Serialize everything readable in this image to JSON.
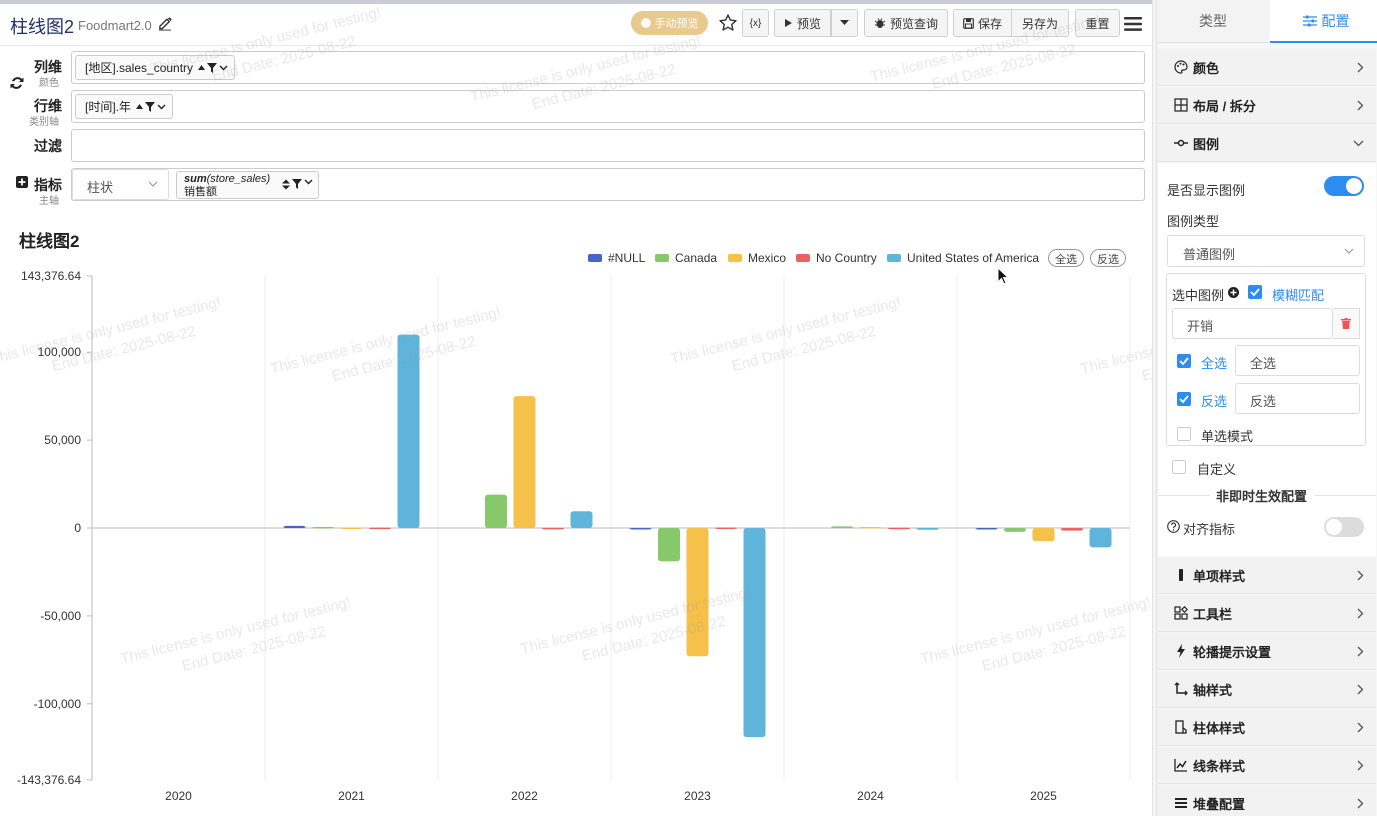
{
  "header": {
    "title": "柱线图2",
    "subtitle": "Foodmart2.0",
    "manual_preview": "手动预览",
    "var_label": "{x}",
    "preview": "预览",
    "preview_query": "预览查询",
    "save": "保存",
    "save_as": "另存为",
    "reset": "重置"
  },
  "shelves": {
    "col": {
      "label": "列维",
      "sub": "颜色",
      "chip": "[地区].sales_country"
    },
    "row": {
      "label": "行维",
      "sub": "类别轴",
      "chip": "[时间].年"
    },
    "filter": {
      "label": "过滤"
    },
    "metric": {
      "label": "指标",
      "sub": "主轴",
      "chart_type": "柱状",
      "chip_func": "sum",
      "chip_field": "(store_sales)",
      "chip_alias": "销售额"
    }
  },
  "chart_data": {
    "type": "bar",
    "title": "柱线图2",
    "categories": [
      "2020",
      "2021",
      "2022",
      "2023",
      "2024",
      "2025"
    ],
    "ylim": [
      -143376.64,
      143376.64
    ],
    "y_ticks": [
      143376.64,
      100000,
      50000,
      0,
      -50000,
      -100000,
      -143376.64
    ],
    "y_tick_labels": [
      "143,376.64",
      "100,000",
      "50,000",
      "0",
      "-50,000",
      "-100,000",
      "-143,376.64"
    ],
    "legend_placement": "top-right",
    "grid": true,
    "series": [
      {
        "name": "#NULL",
        "color": "#4566c6",
        "values": [
          0,
          1200,
          0,
          -600,
          0,
          -500
        ]
      },
      {
        "name": "Canada",
        "color": "#86c86a",
        "values": [
          0,
          600,
          19000,
          -19000,
          900,
          -2200
        ]
      },
      {
        "name": "Mexico",
        "color": "#f6c14a",
        "values": [
          0,
          300,
          75000,
          -73000,
          600,
          -7500
        ]
      },
      {
        "name": "No Country",
        "color": "#ec6060",
        "values": [
          0,
          200,
          100,
          300,
          150,
          -1500
        ]
      },
      {
        "name": "United States of America",
        "color": "#5fb4db",
        "values": [
          0,
          110000,
          9500,
          -119000,
          -1000,
          -11000
        ]
      }
    ],
    "legend_select_all": "全选",
    "legend_invert": "反选"
  },
  "watermark": {
    "line1": "This license is only used for testing!",
    "line2": "End Date: 2025-08-22"
  },
  "panel": {
    "tab_type": "类型",
    "tab_config": "配置",
    "sections": {
      "color": "颜色",
      "layout": "布局 / 拆分",
      "legend": "图例",
      "item_style": "单项样式",
      "toolbar": "工具栏",
      "carousel": "轮播提示设置",
      "axis": "轴样式",
      "bar": "柱体样式",
      "line": "线条样式",
      "stack": "堆叠配置"
    },
    "legend": {
      "show_label": "是否显示图例",
      "show_on": true,
      "type_label": "图例类型",
      "type_value": "普通图例",
      "selected_label": "选中图例",
      "fuzzy_label": "模糊匹配",
      "selected_value": "开销",
      "select_all_label": "全选",
      "select_all_value": "全选",
      "invert_label": "反选",
      "invert_value": "反选",
      "single_mode": "单选模式",
      "custom": "自定义",
      "non_instant": "非即时生效配置",
      "align_metric": "对齐指标",
      "align_on": false
    }
  }
}
